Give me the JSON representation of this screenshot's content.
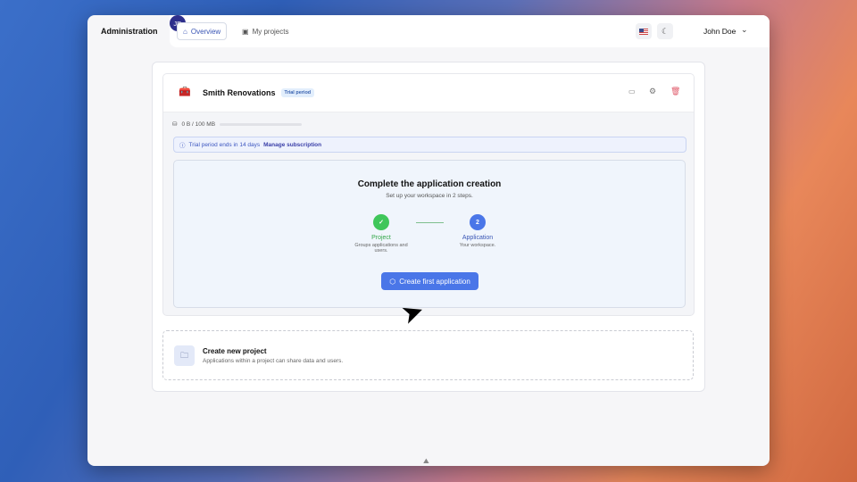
{
  "header": {
    "brand": "Administration",
    "tabs": [
      {
        "label": "Overview",
        "active": true
      },
      {
        "label": "My projects",
        "active": false
      }
    ],
    "user_initials": "JD",
    "user_name": "John Doe"
  },
  "project": {
    "name": "Smith Renovations",
    "badge": "Trial period",
    "storage": "0 B / 100 MB",
    "storage_fraction": 0,
    "info_text": "Trial period ends in 14 days",
    "info_link": "Manage subscription"
  },
  "setup": {
    "title": "Complete the application creation",
    "subtitle": "Set up your workspace in 2 steps.",
    "steps": [
      {
        "label": "Project",
        "desc": "Groups applications and users.",
        "status": "done",
        "marker": "✓"
      },
      {
        "label": "Application",
        "desc": "Your workspace.",
        "status": "current",
        "marker": "2"
      }
    ],
    "button": "Create first application"
  },
  "new_project": {
    "title": "Create new project",
    "desc": "Applications within a project can share data and users."
  },
  "colors": {
    "accent": "#4a76e8",
    "success": "#3fc65a",
    "danger": "#e05a6a"
  }
}
